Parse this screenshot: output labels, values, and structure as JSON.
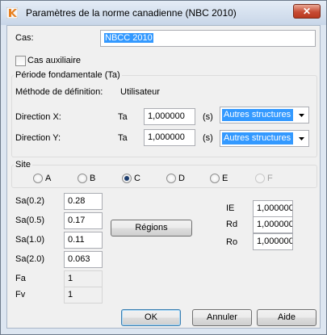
{
  "window": {
    "title": "Paramètres de la norme canadienne (NBC 2010)"
  },
  "cas": {
    "label": "Cas:",
    "value": "NBCC 2010"
  },
  "auxiliary": {
    "label": "Cas auxiliaire",
    "checked": false
  },
  "period": {
    "title": "Période fondamentale (Ta)",
    "method_label": "Méthode de définition:",
    "method_value": "Utilisateur",
    "x": {
      "label": "Direction X:",
      "ta": "Ta",
      "value": "1,000000",
      "unit": "(s)",
      "structure": "Autres structures"
    },
    "y": {
      "label": "Direction Y:",
      "ta": "Ta",
      "value": "1,000000",
      "unit": "(s)",
      "structure": "Autres structures"
    }
  },
  "site": {
    "title": "Site",
    "options": [
      "A",
      "B",
      "C",
      "D",
      "E",
      "F"
    ],
    "selected": "C",
    "disabled": [
      "F"
    ]
  },
  "sa": [
    {
      "label": "Sa(0.2)",
      "value": "0.28"
    },
    {
      "label": "Sa(0.5)",
      "value": "0.17"
    },
    {
      "label": "Sa(1.0)",
      "value": "0.11"
    },
    {
      "label": "Sa(2.0)",
      "value": "0.063"
    }
  ],
  "fa": {
    "label": "Fa",
    "value": "1"
  },
  "fv": {
    "label": "Fv",
    "value": "1"
  },
  "regions_button": "Régions",
  "factors": [
    {
      "label": "IE",
      "value": "1,000000"
    },
    {
      "label": "Rd",
      "value": "1,000000"
    },
    {
      "label": "Ro",
      "value": "1,000000"
    }
  ],
  "buttons": {
    "ok": "OK",
    "cancel": "Annuler",
    "help": "Aide"
  },
  "colors": {
    "selection": "#3399ff",
    "close": "#c74b34"
  }
}
